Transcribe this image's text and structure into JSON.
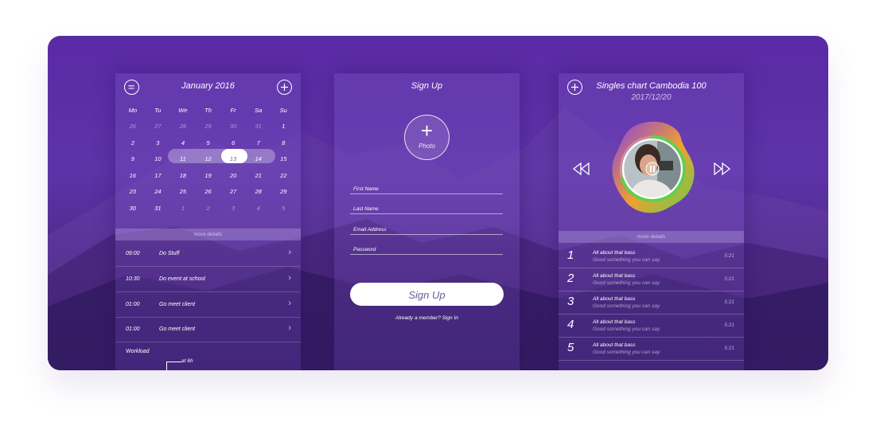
{
  "calendar": {
    "title": "January 2016",
    "weekdays": [
      "Mo",
      "Tu",
      "We",
      "Th",
      "Fr",
      "Sa",
      "Su"
    ],
    "weeks": [
      [
        "26",
        "27",
        "28",
        "29",
        "30",
        "31",
        "1"
      ],
      [
        "2",
        "3",
        "4",
        "5",
        "6",
        "7",
        "8"
      ],
      [
        "9",
        "10",
        "11",
        "12",
        "13",
        "14",
        "15"
      ],
      [
        "16",
        "17",
        "18",
        "19",
        "20",
        "21",
        "22"
      ],
      [
        "23",
        "24",
        "25",
        "26",
        "27",
        "28",
        "29"
      ],
      [
        "30",
        "31",
        "1",
        "2",
        "3",
        "4",
        "5"
      ]
    ],
    "selected_day": "13",
    "more_details": "more details",
    "events": [
      {
        "time": "09:00",
        "text": "Do Stuff"
      },
      {
        "time": "10:30",
        "text": "Do event at school"
      },
      {
        "time": "01:00",
        "text": "Go meet client"
      },
      {
        "time": "01:00",
        "text": "Go meet client"
      }
    ],
    "workload_label": "Workload",
    "workload_note": "at 6h"
  },
  "signup": {
    "title": "Sign Up",
    "photo_label": "Photo",
    "fields": {
      "first_name": "First Name",
      "last_name": "Last Name",
      "email": "Email Address",
      "password": "Password"
    },
    "button_label": "Sign Up",
    "member_link": "Already a member? Sign In"
  },
  "music": {
    "title": "Singles chart Cambodia 100",
    "date": "2017/12/20",
    "more_details": "more details",
    "songs": [
      {
        "num": "1",
        "title": "All about that bass",
        "subtitle": "Good something you can say",
        "duration": "5:21"
      },
      {
        "num": "2",
        "title": "All about that bass",
        "subtitle": "Good something you can say",
        "duration": "5:21"
      },
      {
        "num": "3",
        "title": "All about that bass",
        "subtitle": "Good something you can say",
        "duration": "5:21"
      },
      {
        "num": "4",
        "title": "All about that bass",
        "subtitle": "Good something you can say",
        "duration": "5:21"
      },
      {
        "num": "5",
        "title": "All about that bass",
        "subtitle": "Good something you can say",
        "duration": "5:21"
      }
    ],
    "progress": 0.7
  },
  "colors": {
    "background": "#5a2aa4",
    "accent_green": "#5fd04e",
    "accent_orange": "#f0a030",
    "accent_purple": "#8a3ee0"
  }
}
